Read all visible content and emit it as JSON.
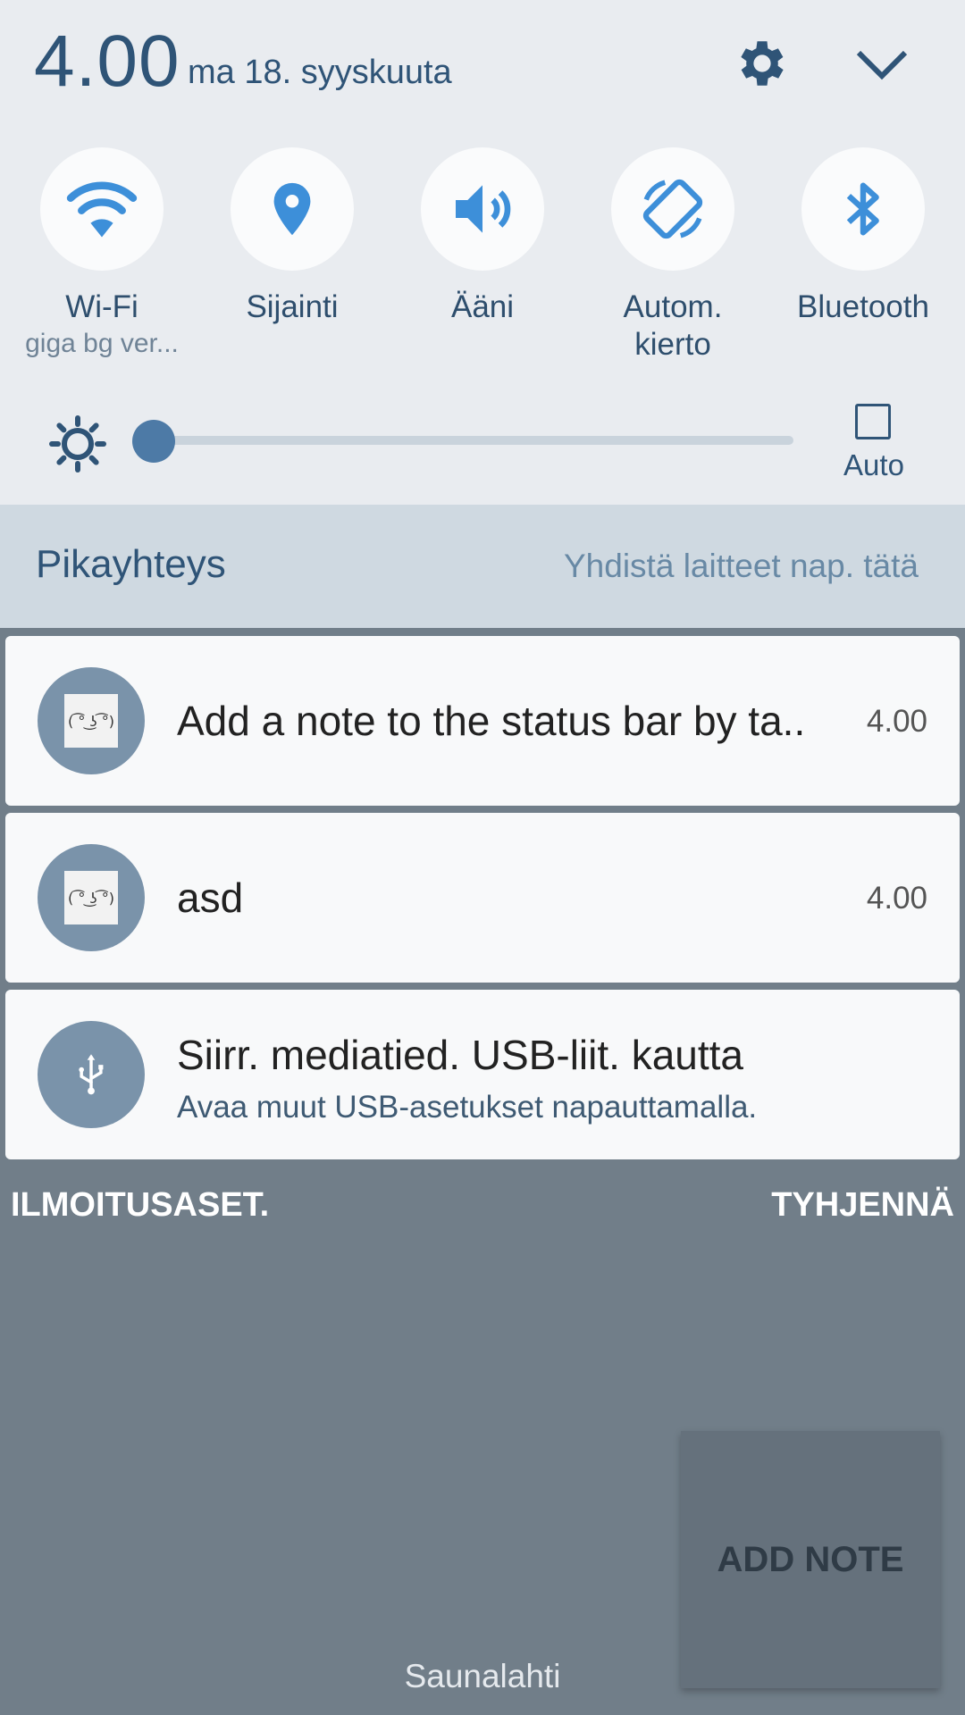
{
  "header": {
    "time": "4.00",
    "date": "ma 18. syyskuuta"
  },
  "toggles": [
    {
      "label": "Wi-Fi",
      "sub": "giga bg ver...",
      "icon": "wifi-icon"
    },
    {
      "label": "Sijainti",
      "sub": "",
      "icon": "location-icon"
    },
    {
      "label": "Ääni",
      "sub": "",
      "icon": "sound-icon"
    },
    {
      "label": "Autom.",
      "label2": "kierto",
      "icon": "rotate-icon"
    },
    {
      "label": "Bluetooth",
      "sub": "",
      "icon": "bluetooth-icon"
    }
  ],
  "brightness": {
    "level": 0.0,
    "auto_label": "Auto",
    "auto_checked": false
  },
  "quick_connect": {
    "title": "Pikayhteys",
    "hint": "Yhdistä laitteet nap. tätä"
  },
  "notifications": [
    {
      "title": "Add a note to the status bar by ta..",
      "time": "4.00",
      "face": "( ͡° ͜ʖ ͡°)"
    },
    {
      "title": "asd",
      "time": "4.00",
      "face": "( ͡° ͜ʖ ͡°)"
    },
    {
      "title": "Siirr. mediatied. USB-liit. kautta",
      "sub": "Avaa muut USB-asetukset napauttamalla."
    }
  ],
  "footer": {
    "settings_label": "ILMOITUSASET.",
    "clear_label": "TYHJENNÄ"
  },
  "add_note_label": "ADD NOTE",
  "carrier": "Saunalahti",
  "colors": {
    "accent": "#3d8fd9",
    "panel": "#e9ecf0",
    "text_dark_blue": "#2f5477",
    "backdrop": "#717e89"
  }
}
